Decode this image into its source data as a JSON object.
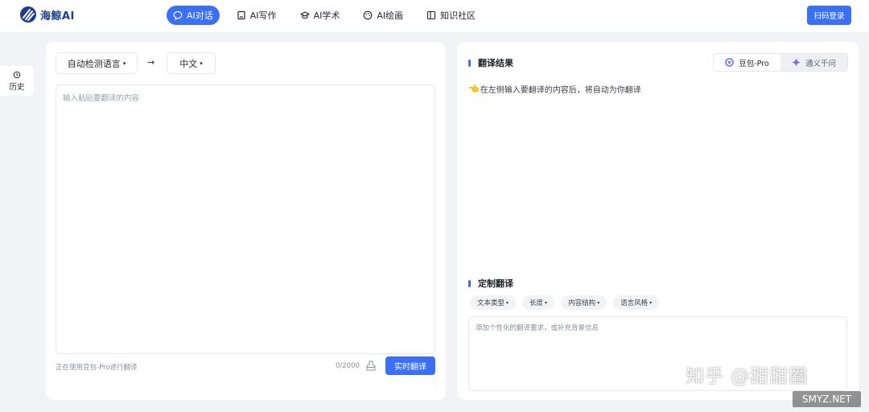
{
  "header": {
    "brand": "海鲸AI",
    "nav": [
      {
        "label": "AI对话",
        "icon": "chat-icon",
        "active": true
      },
      {
        "label": "AI写作",
        "icon": "writing-icon",
        "active": false
      },
      {
        "label": "AI学术",
        "icon": "graduation-cap-icon",
        "active": false
      },
      {
        "label": "AI绘画",
        "icon": "palette-icon",
        "active": false
      },
      {
        "label": "知识社区",
        "icon": "book-icon",
        "active": false
      }
    ],
    "login_label": "扫码登录"
  },
  "sidebar": {
    "history_label": "历史"
  },
  "source": {
    "source_lang": "自动检测语言",
    "target_lang": "中文",
    "placeholder": "输入粘贴要翻译的内容",
    "model_note": "正在使用豆包-Pro进行翻译",
    "char_count": "0/2000",
    "translate_label": "实时翻译"
  },
  "result": {
    "title": "翻译结果",
    "engines": [
      {
        "label": "豆包-Pro",
        "selected": true
      },
      {
        "label": "通义千问",
        "selected": false
      }
    ],
    "hint": "在左侧输入要翻译的内容后，将自动为你翻译"
  },
  "custom": {
    "title": "定制翻译",
    "tags": [
      "文本类型",
      "长度",
      "内容结构",
      "语言风格"
    ],
    "placeholder": "添加个性化的翻译要求，或补充背景信息"
  },
  "watermarks": {
    "zhihu": "知乎 @甜甜圈",
    "site": "SMYZ.NET"
  },
  "colors": {
    "accent": "#3a6ff7",
    "brand": "#1b3d8f"
  }
}
